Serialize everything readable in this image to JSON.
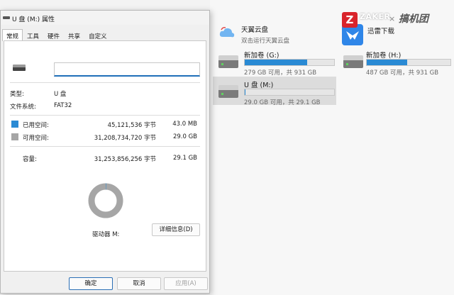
{
  "explorer": {
    "tiles": [
      {
        "title": "天翼云盘",
        "subtitle": "双击运行天翼云盘"
      },
      {
        "title": "迅雷下载",
        "subtitle": ""
      }
    ],
    "drives": [
      {
        "name": "新加卷 (G:)",
        "free_text": "279 GB 可用，共 931 GB",
        "used_fraction": 0.7
      },
      {
        "name": "新加卷 (H:)",
        "free_text": "487 GB 可用，共 931 GB",
        "used_fraction": 0.48
      },
      {
        "name": "U 盘 (M:)",
        "free_text": "29.0 GB 可用，共 29.1 GB",
        "used_fraction": 0.01
      }
    ]
  },
  "watermark": {
    "logo_letter": "Z",
    "name": "ZAKER",
    "sep": "×",
    "brand": "搞机团"
  },
  "dialog": {
    "title": "U 盘 (M:) 属性",
    "tabs": [
      "常规",
      "工具",
      "硬件",
      "共享",
      "自定义"
    ],
    "volume_name": "",
    "type_label": "类型:",
    "type_value": "U 盘",
    "fs_label": "文件系统:",
    "fs_value": "FAT32",
    "used_label": "已用空间:",
    "used_bytes": "45,121,536 字节",
    "used_size": "43.0 MB",
    "free_label": "可用空间:",
    "free_bytes": "31,208,734,720 字节",
    "free_size": "29.0 GB",
    "capacity_label": "容量:",
    "capacity_bytes": "31,253,856,256 字节",
    "capacity_size": "29.1 GB",
    "drive_label": "驱动器 M:",
    "details_button": "详细信息(D)",
    "used_fraction": 0.0014,
    "colors": {
      "used": "#2a8ad4",
      "free": "#a6a6a6"
    },
    "buttons": {
      "ok": "确定",
      "cancel": "取消",
      "apply": "应用(A)"
    }
  }
}
